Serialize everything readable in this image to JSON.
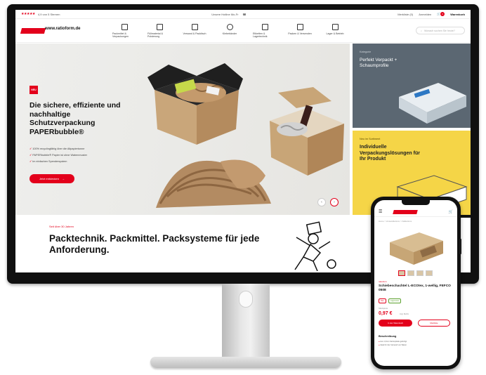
{
  "topbar": {
    "rating_stars": "★★★★★",
    "rating_text": "4,9 von 5 Sternen",
    "hours": "Unsere Hotline Mo-Fr",
    "phone": "+49 (0) 2145 4820-22",
    "links": [
      "Merkliste (0)",
      "Anmelden"
    ],
    "cart_label": "Warenkorb",
    "cart_count": "0"
  },
  "header": {
    "logo_text": "www.ratioform.de",
    "nav": [
      "Packmittel & Verpackungen",
      "Füllmaterial & Polsterung",
      "Versand & Packtisch",
      "Klebebänder",
      "Etiketten & Lagertechnik",
      "Packen & Versenden",
      "Lager & Betrieb"
    ],
    "search_placeholder": "Wonach suchen Sie heute?"
  },
  "hero": {
    "badge": "NEU",
    "title": "Die sichere, effiziente und nachhaltige Schutzverpackung PAPERbubble®",
    "bullets": [
      "100% recyclingfähig über die Altpapiertonne",
      "PAPERbubble® Papier ist ohne Wabenmuster",
      "Im einfachen Spendersystem"
    ],
    "cta": "Jetzt entdecken",
    "cta_arrow": "→",
    "prev": "‹",
    "next": "›"
  },
  "tiles": [
    {
      "caption": "Kategorie",
      "title": "Perfekt Verpackt + Schaumprofile"
    },
    {
      "caption": "Neu im Sortiment",
      "title": "Individuelle Verpackungslösungen für Ihr Produkt"
    }
  ],
  "band": {
    "caption": "Seit über 30 Jahren",
    "title": "Packtechnik. Packmittel. Packsysteme für jede Anforderung."
  },
  "phone": {
    "menu": "☰",
    "cart": "🛒",
    "breadcrumb": "Home > Versandkartons > Faltkartons",
    "brand": "ratioform",
    "title": "Schiebeschachtel L-ECOtex, 1-wellig, FEFCO 0508",
    "tags": [
      "Neu",
      "Lagerware"
    ],
    "price_label": "Stückpreis",
    "price": "0,97 €",
    "price_sub": "zzgl. MwSt.",
    "btn_primary": "In den Warenkorb",
    "btn_secondary": "Merkliste",
    "section": "Beschreibung",
    "list": [
      "Aus 1,3mm Kartonplatte gefertigt",
      "Ideal für den Versand von Waren"
    ]
  }
}
